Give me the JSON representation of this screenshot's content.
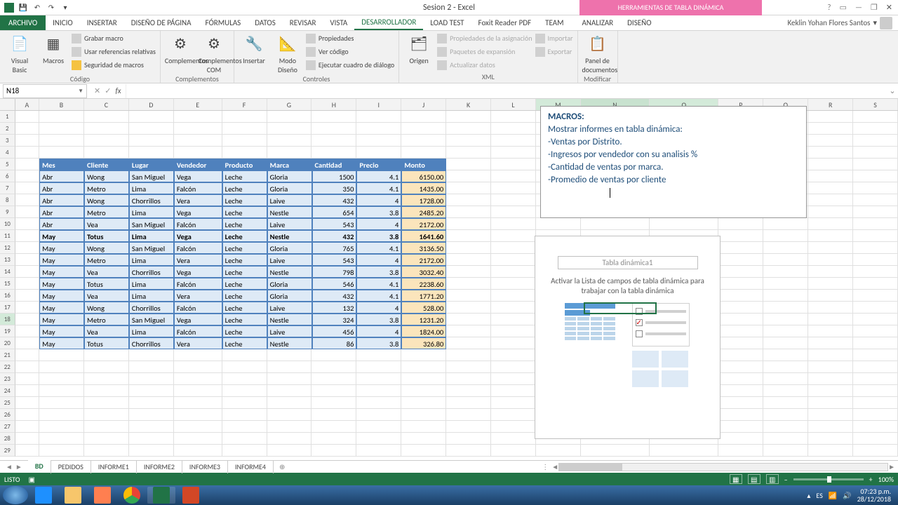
{
  "app": {
    "title": "Sesion 2 - Excel",
    "tools_title": "HERRAMIENTAS DE TABLA DINÁMICA"
  },
  "qat": {
    "save": "💾",
    "undo": "↶",
    "redo": "↷"
  },
  "win": {
    "help": "?",
    "opts": "⋯",
    "min": "—",
    "restore": "❐",
    "close": "✕"
  },
  "tabs": {
    "file": "ARCHIVO",
    "inicio": "INICIO",
    "insertar": "INSERTAR",
    "diseno_pagina": "DISEÑO DE PÁGINA",
    "formulas": "FÓRMULAS",
    "datos": "DATOS",
    "revisar": "REVISAR",
    "vista": "VISTA",
    "desarrollador": "DESARROLLADOR",
    "loadtest": "LOAD TEST",
    "foxit": "Foxit Reader PDF",
    "team": "TEAM",
    "analizar": "ANALIZAR",
    "diseno": "DISEÑO"
  },
  "user": "Keklin Yohan Flores Santos",
  "ribbon": {
    "codigo": {
      "visual_basic": "Visual Basic",
      "macros": "Macros",
      "grabar": "Grabar macro",
      "refrel": "Usar referencias relativas",
      "seguridad": "Seguridad de macros",
      "label": "Código"
    },
    "complementos": {
      "complementos": "Complementos",
      "com": "Complementos COM",
      "label": "Complementos"
    },
    "controles": {
      "insertar": "Insertar",
      "modo_diseno": "Modo Diseño",
      "propiedades": "Propiedades",
      "ver_codigo": "Ver código",
      "ejecutar": "Ejecutar cuadro de diálogo",
      "label": "Controles"
    },
    "xml": {
      "origen": "Origen",
      "propiedades": "Propiedades de la asignación",
      "paquetes": "Paquetes de expansión",
      "actualizar": "Actualizar datos",
      "importar": "Importar",
      "exportar": "Exportar",
      "label": "XML"
    },
    "modificar": {
      "panel": "Panel de documentos",
      "label": "Modificar"
    }
  },
  "namebox": "N18",
  "cols": [
    "A",
    "B",
    "C",
    "D",
    "E",
    "F",
    "G",
    "H",
    "I",
    "J",
    "K",
    "L",
    "M",
    "N",
    "O",
    "P",
    "Q",
    "R",
    "S"
  ],
  "table": {
    "headers": [
      "Mes",
      "Cliente",
      "Lugar",
      "Vendedor",
      "Producto",
      "Marca",
      "Cantidad",
      "Precio",
      "Monto"
    ],
    "rows": [
      [
        "Abr",
        "Wong",
        "San Miguel",
        "Vega",
        "Leche",
        "Gloria",
        "1500",
        "4.1",
        "6150.00"
      ],
      [
        "Abr",
        "Metro",
        "Lima",
        "Falcón",
        "Leche",
        "Gloria",
        "350",
        "4.1",
        "1435.00"
      ],
      [
        "Abr",
        "Wong",
        "Chorrillos",
        "Vera",
        "Leche",
        "Laive",
        "432",
        "4",
        "1728.00"
      ],
      [
        "Abr",
        "Metro",
        "Lima",
        "Vega",
        "Leche",
        "Nestle",
        "654",
        "3.8",
        "2485.20"
      ],
      [
        "Abr",
        "Vea",
        "San Miguel",
        "Falcón",
        "Leche",
        "Laive",
        "543",
        "4",
        "2172.00"
      ],
      [
        "May",
        "Totus",
        "Lima",
        "Vega",
        "Leche",
        "Nestle",
        "432",
        "3.8",
        "1641.60"
      ],
      [
        "May",
        "Wong",
        "San Miguel",
        "Falcón",
        "Leche",
        "Gloria",
        "765",
        "4.1",
        "3136.50"
      ],
      [
        "May",
        "Metro",
        "Lima",
        "Vera",
        "Leche",
        "Laive",
        "543",
        "4",
        "2172.00"
      ],
      [
        "May",
        "Vea",
        "Chorrillos",
        "Vega",
        "Leche",
        "Nestle",
        "798",
        "3.8",
        "3032.40"
      ],
      [
        "May",
        "Totus",
        "Lima",
        "Falcón",
        "Leche",
        "Gloria",
        "546",
        "4.1",
        "2238.60"
      ],
      [
        "May",
        "Vea",
        "Lima",
        "Vera",
        "Leche",
        "Gloria",
        "432",
        "4.1",
        "1771.20"
      ],
      [
        "May",
        "Wong",
        "Chorrillos",
        "Falcón",
        "Leche",
        "Laive",
        "132",
        "4",
        "528.00"
      ],
      [
        "May",
        "Metro",
        "San Miguel",
        "Vega",
        "Leche",
        "Nestle",
        "324",
        "3.8",
        "1231.20"
      ],
      [
        "May",
        "Vea",
        "Lima",
        "Falcón",
        "Leche",
        "Laive",
        "456",
        "4",
        "1824.00"
      ],
      [
        "May",
        "Totus",
        "Chorrillos",
        "Vera",
        "Leche",
        "Nestle",
        "86",
        "3.8",
        "326.80"
      ]
    ],
    "bold_row_index": 5
  },
  "macros": {
    "title": "MACROS:",
    "subtitle": "Mostrar informes en tabla dinámica:",
    "lines": [
      "-Ventas por Distrito.",
      "-Ingresos por vendedor con su analisis %",
      "-Cantidad de ventas por marca.",
      "-Promedio de ventas por cliente"
    ]
  },
  "pivot": {
    "name": "Tabla dinámica1",
    "hint": "Activar la Lista de campos de tabla dinámica para trabajar con la tabla dinámica"
  },
  "sheets": {
    "bd": "BD",
    "pedidos": "PEDIDOS",
    "inf1": "INFORME1",
    "inf2": "INFORME2",
    "inf3": "INFORME3",
    "inf4": "INFORME4"
  },
  "status": {
    "listo": "LISTO",
    "zoom": "100%",
    "plus": "+",
    "minus": "–"
  },
  "tray": {
    "lang": "ES",
    "time": "07:23 p.m.",
    "date": "28/12/2018"
  }
}
